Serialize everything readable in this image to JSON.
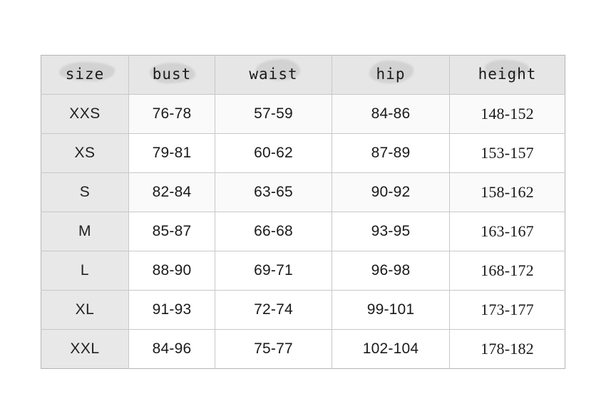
{
  "table": {
    "name": "size-chart",
    "columns": [
      {
        "key": "size",
        "label": "size"
      },
      {
        "key": "bust",
        "label": "bust"
      },
      {
        "key": "waist",
        "label": "waist"
      },
      {
        "key": "hip",
        "label": "hip"
      },
      {
        "key": "height",
        "label": "height"
      }
    ],
    "rows": [
      {
        "size": "XXS",
        "bust": "76-78",
        "waist": "57-59",
        "hip": "84-86",
        "height": "148-152"
      },
      {
        "size": "XS",
        "bust": "79-81",
        "waist": "60-62",
        "hip": "87-89",
        "height": "153-157"
      },
      {
        "size": "S",
        "bust": "82-84",
        "waist": "63-65",
        "hip": "90-92",
        "height": "158-162"
      },
      {
        "size": "M",
        "bust": "85-87",
        "waist": "66-68",
        "hip": "93-95",
        "height": "163-167"
      },
      {
        "size": "L",
        "bust": "88-90",
        "waist": "69-71",
        "hip": "96-98",
        "height": "168-172"
      },
      {
        "size": "XL",
        "bust": "91-93",
        "waist": "72-74",
        "hip": "99-101",
        "height": "173-177"
      },
      {
        "size": "XXL",
        "bust": "84-96",
        "waist": "75-77",
        "hip": "102-104",
        "height": "178-182"
      }
    ]
  },
  "colors": {
    "page_background": "#ffffff",
    "header_background": "#e6e6e6",
    "size_column_background": "#e8e8e8",
    "row_tint_background": "#fafafa",
    "smudge": "#d2d2d2",
    "grid_line": "#c8c8c8",
    "outer_border": "#b4b4b4",
    "text": "#1a1a1a"
  }
}
